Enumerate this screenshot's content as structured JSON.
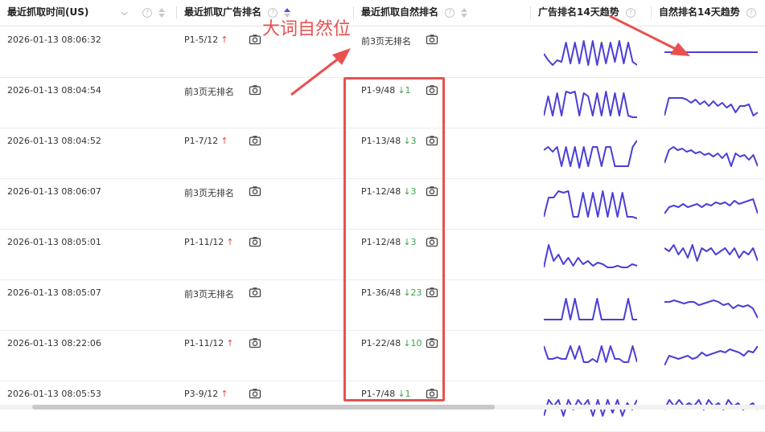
{
  "columns": {
    "time": "最近抓取时间(US)",
    "ad_rank": "最近抓取广告排名",
    "natural_rank": "最近抓取自然排名",
    "ad_trend": "广告排名14天趋势",
    "natural_trend": "自然排名14天趋势"
  },
  "annotation": "大词自然位",
  "rows": [
    {
      "time": "2026-01-13 08:06:32",
      "ad": "P1-5/12",
      "ad_dir": "↑",
      "natural": "前3页无排名",
      "nat_dir": "",
      "ad_trend": [
        0.55,
        0.75,
        0.9,
        0.75,
        0.8,
        0.2,
        0.85,
        0.2,
        0.85,
        0.15,
        0.9,
        0.15,
        0.9,
        0.2,
        0.85,
        0.2,
        0.8,
        0.15,
        0.85,
        0.2,
        0.8,
        0.9
      ],
      "nat_trend": [
        0.5,
        0.5,
        0.5,
        0.5,
        0.5,
        0.5,
        0.5,
        0.5,
        0.5,
        0.5,
        0.5,
        0.5,
        0.5,
        0.5
      ]
    },
    {
      "time": "2026-01-13 08:04:54",
      "ad": "前3页无排名",
      "ad_dir": "",
      "natural": "P1-9/48",
      "nat_dir": "↓1",
      "ad_trend": [
        0.9,
        0.3,
        0.9,
        0.2,
        0.9,
        0.15,
        0.2,
        0.15,
        0.9,
        0.2,
        0.3,
        0.9,
        0.2,
        0.9,
        0.15,
        0.9,
        0.2,
        0.9,
        0.2,
        0.9,
        0.95,
        0.95
      ],
      "nat_trend": [
        0.9,
        0.35,
        0.35,
        0.35,
        0.35,
        0.4,
        0.5,
        0.4,
        0.55,
        0.45,
        0.6,
        0.45,
        0.6,
        0.5,
        0.65,
        0.55,
        0.8,
        0.6,
        0.6,
        0.55,
        0.9,
        0.8
      ]
    },
    {
      "time": "2026-01-13 08:04:52",
      "ad": "P1-7/12",
      "ad_dir": "↑",
      "natural": "P1-13/48",
      "nat_dir": "↓3",
      "ad_trend": [
        0.4,
        0.3,
        0.45,
        0.3,
        0.9,
        0.3,
        0.9,
        0.3,
        0.95,
        0.3,
        0.9,
        0.3,
        0.3,
        0.9,
        0.3,
        0.3,
        0.9,
        0.9,
        0.9,
        0.9,
        0.3,
        0.1
      ],
      "nat_trend": [
        0.8,
        0.4,
        0.3,
        0.4,
        0.35,
        0.45,
        0.4,
        0.5,
        0.45,
        0.55,
        0.5,
        0.6,
        0.5,
        0.65,
        0.5,
        0.9,
        0.5,
        0.6,
        0.55,
        0.7,
        0.55,
        0.9
      ]
    },
    {
      "time": "2026-01-13 08:06:07",
      "ad": "前3页无排名",
      "ad_dir": "",
      "natural": "P1-12/48",
      "nat_dir": "↓3",
      "ad_trend": [
        0.9,
        0.3,
        0.3,
        0.1,
        0.15,
        0.1,
        0.9,
        0.9,
        0.15,
        0.9,
        0.15,
        0.9,
        0.1,
        0.9,
        0.15,
        0.9,
        0.15,
        0.9,
        0.9,
        0.95
      ],
      "nat_trend": [
        0.8,
        0.6,
        0.55,
        0.6,
        0.5,
        0.6,
        0.55,
        0.5,
        0.6,
        0.5,
        0.55,
        0.45,
        0.5,
        0.45,
        0.55,
        0.4,
        0.5,
        0.45,
        0.4,
        0.35,
        0.8
      ]
    },
    {
      "time": "2026-01-13 08:05:01",
      "ad": "P1-11/12",
      "ad_dir": "↑",
      "natural": "P1-12/48",
      "nat_dir": "↓3",
      "ad_trend": [
        0.9,
        0.2,
        0.7,
        0.5,
        0.8,
        0.6,
        0.85,
        0.6,
        0.8,
        0.7,
        0.85,
        0.75,
        0.8,
        0.9,
        0.9,
        0.85,
        0.9,
        0.9,
        0.8,
        0.85
      ],
      "nat_trend": [
        0.3,
        0.4,
        0.2,
        0.5,
        0.3,
        0.6,
        0.2,
        0.7,
        0.3,
        0.4,
        0.3,
        0.5,
        0.4,
        0.3,
        0.5,
        0.3,
        0.6,
        0.4,
        0.5,
        0.3,
        0.7
      ]
    },
    {
      "time": "2026-01-13 08:05:07",
      "ad": "前3页无排名",
      "ad_dir": "",
      "natural": "P1-36/48",
      "nat_dir": "↓23",
      "ad_trend": [
        0.95,
        0.95,
        0.95,
        0.95,
        0.95,
        0.3,
        0.95,
        0.3,
        0.95,
        0.95,
        0.95,
        0.95,
        0.3,
        0.95,
        0.95,
        0.95,
        0.95,
        0.95,
        0.95,
        0.3,
        0.95,
        0.95
      ],
      "nat_trend": [
        0.4,
        0.4,
        0.35,
        0.4,
        0.45,
        0.4,
        0.4,
        0.5,
        0.45,
        0.4,
        0.35,
        0.4,
        0.5,
        0.45,
        0.6,
        0.5,
        0.55,
        0.5,
        0.6,
        0.9
      ]
    },
    {
      "time": "2026-01-13 08:22:06",
      "ad": "P1-11/12",
      "ad_dir": "↑",
      "natural": "P1-22/48",
      "nat_dir": "↓10",
      "ad_trend": [
        0.2,
        0.6,
        0.6,
        0.55,
        0.6,
        0.6,
        0.2,
        0.6,
        0.2,
        0.7,
        0.7,
        0.6,
        0.7,
        0.2,
        0.7,
        0.2,
        0.6,
        0.6,
        0.7,
        0.7,
        0.2,
        0.7
      ],
      "nat_trend": [
        0.8,
        0.5,
        0.55,
        0.6,
        0.55,
        0.5,
        0.6,
        0.55,
        0.4,
        0.5,
        0.45,
        0.4,
        0.35,
        0.4,
        0.3,
        0.35,
        0.4,
        0.5,
        0.35,
        0.4,
        0.2
      ]
    },
    {
      "time": "2026-01-13 08:05:53",
      "ad": "P3-9/12",
      "ad_dir": "↑",
      "natural": "P1-7/48",
      "nat_dir": "↓1",
      "ad_trend": [
        0.8,
        0.3,
        0.5,
        0.3,
        0.8,
        0.3,
        0.6,
        0.3,
        0.5,
        0.3,
        0.8,
        0.3,
        0.8,
        0.3,
        0.7,
        0.3,
        0.8,
        0.4,
        0.6,
        0.3
      ],
      "nat_trend": [
        0.6,
        0.3,
        0.5,
        0.3,
        0.5,
        0.4,
        0.5,
        0.3,
        0.6,
        0.3,
        0.5,
        0.4,
        0.6,
        0.3,
        0.5,
        0.4,
        0.6,
        0.5,
        0.4,
        0.6
      ]
    }
  ],
  "colors": {
    "line": "#4b3fd6",
    "up": "#e24b4b",
    "down": "#3aa64a",
    "annotation": "#e8514f"
  }
}
